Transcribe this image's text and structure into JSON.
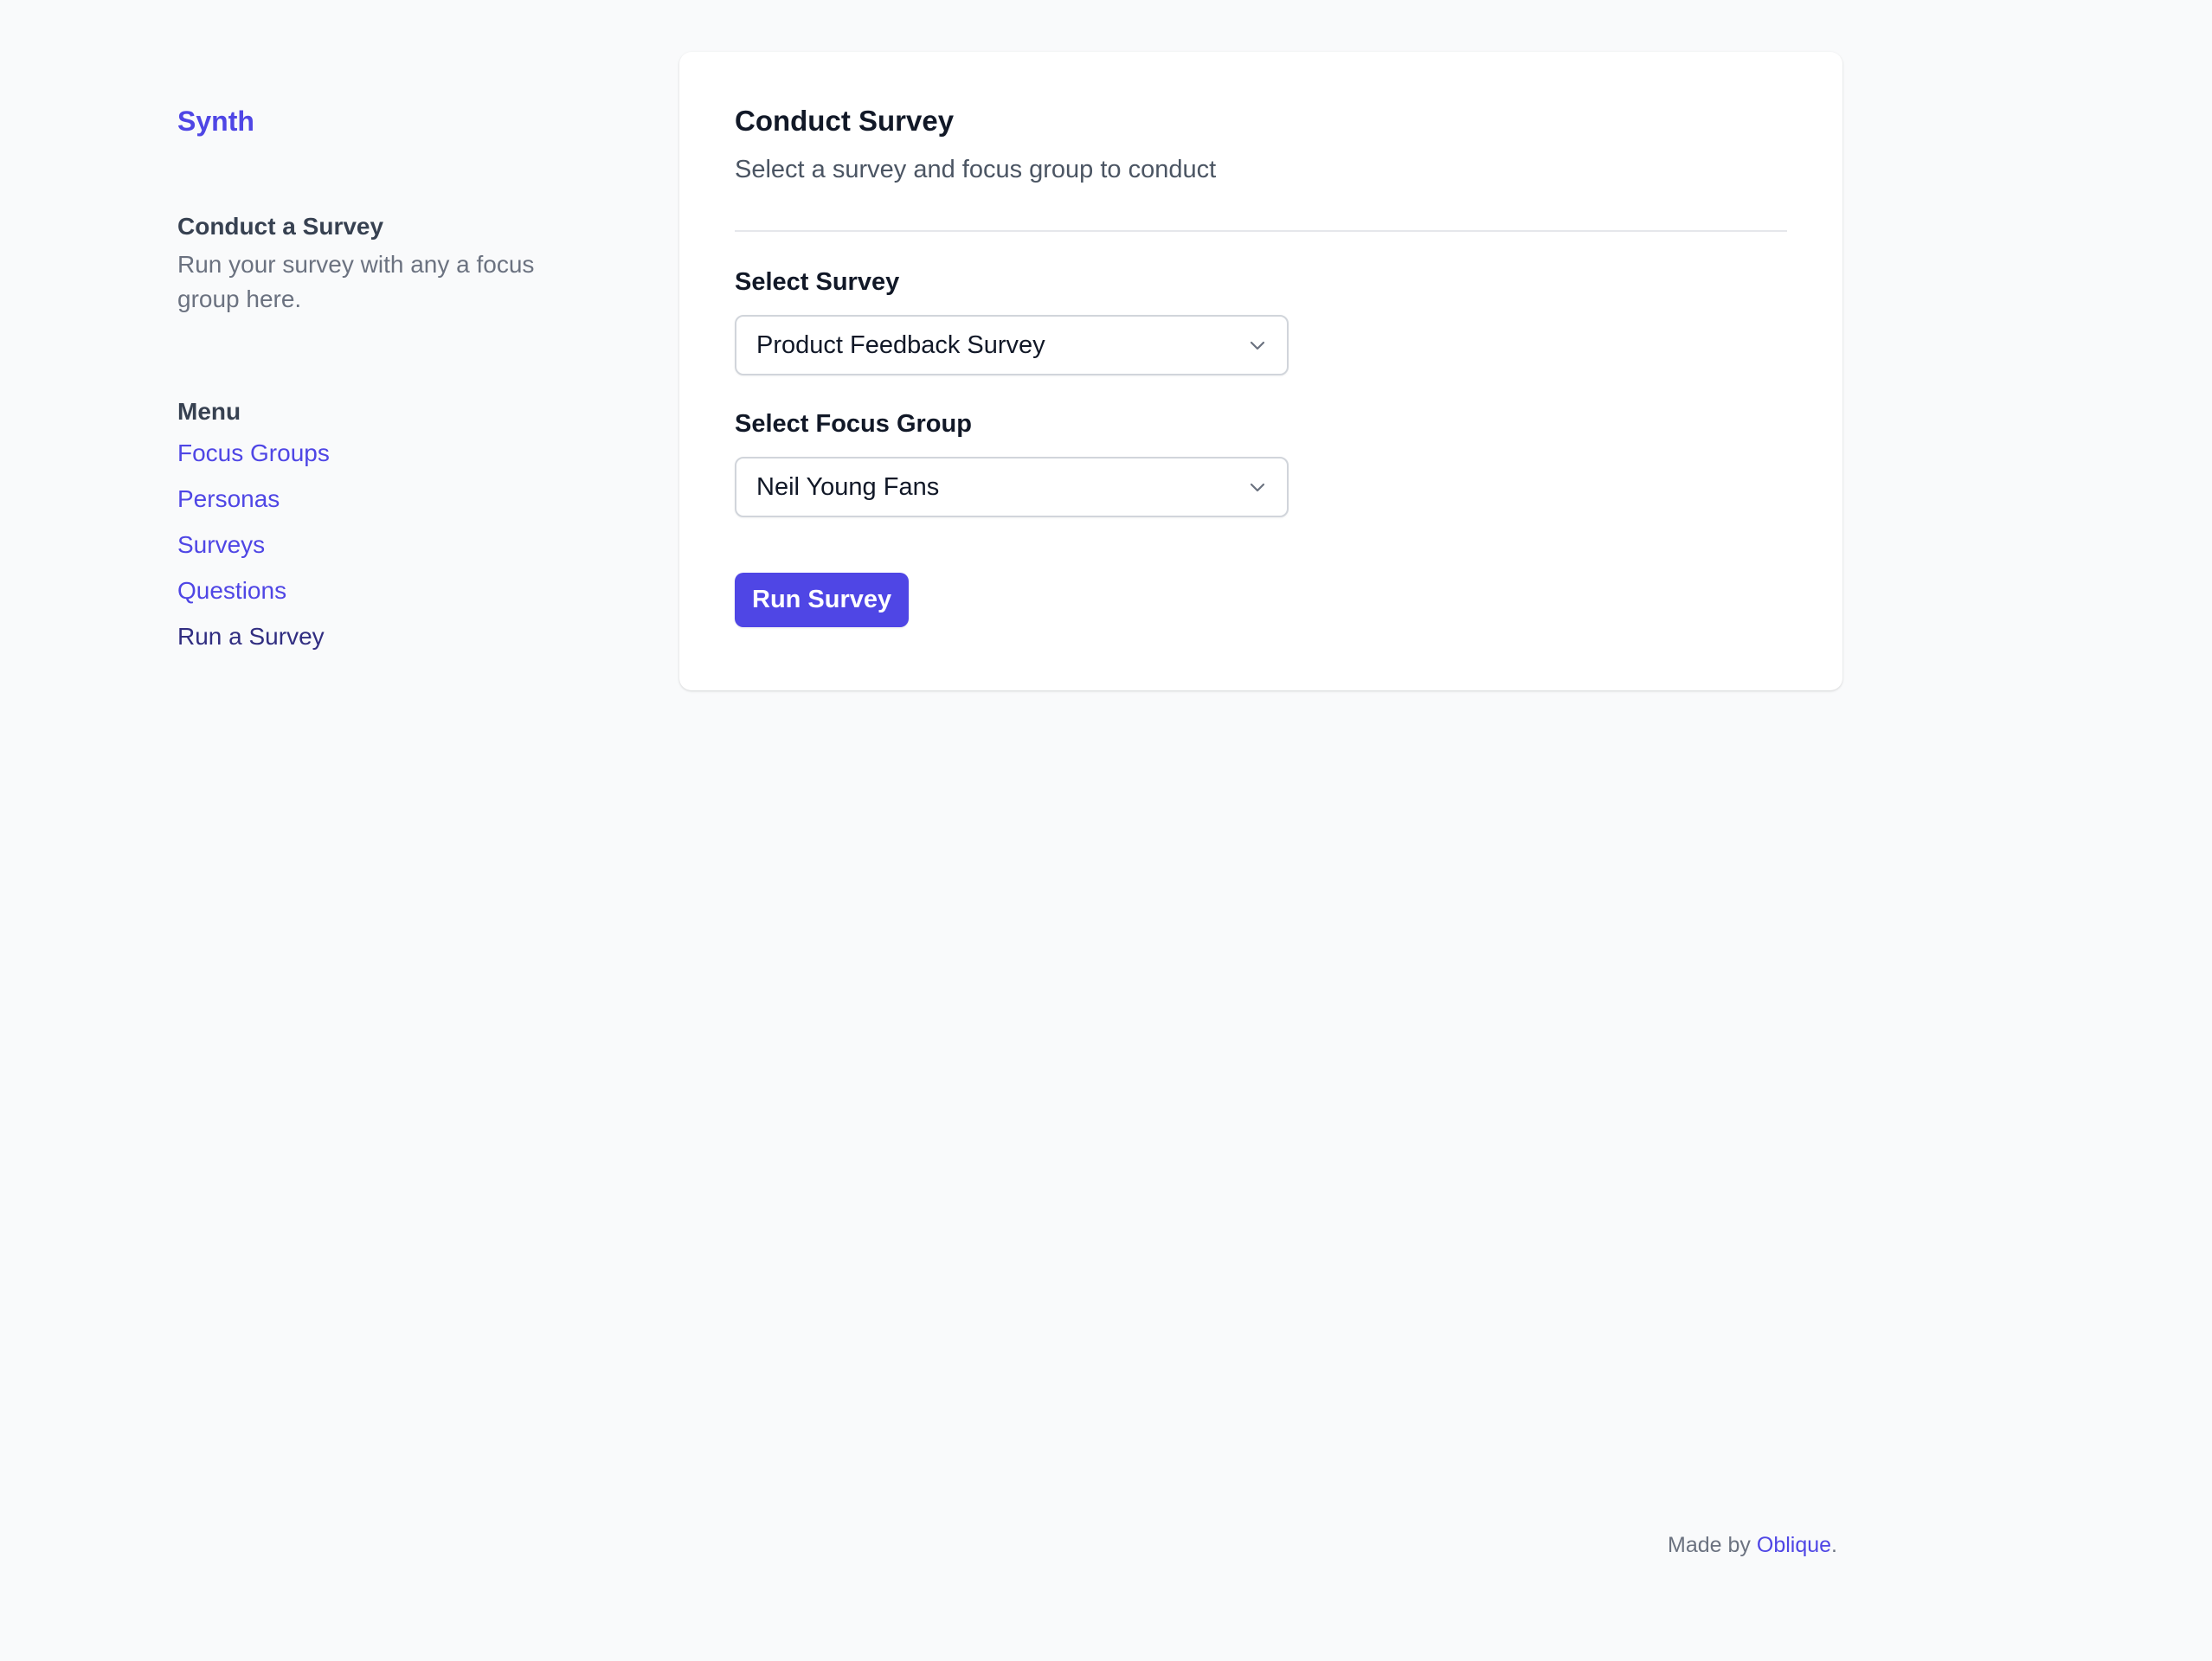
{
  "app": {
    "brand": "Synth"
  },
  "sidebar": {
    "section_title": "Conduct a Survey",
    "section_description": "Run your survey with any a focus group here.",
    "menu_title": "Menu",
    "items": [
      {
        "label": "Focus Groups",
        "active": false
      },
      {
        "label": "Personas",
        "active": false
      },
      {
        "label": "Surveys",
        "active": false
      },
      {
        "label": "Questions",
        "active": false
      },
      {
        "label": "Run a Survey",
        "active": true
      }
    ]
  },
  "card": {
    "title": "Conduct Survey",
    "subtitle": "Select a survey and focus group to conduct",
    "survey_field": {
      "label": "Select Survey",
      "value": "Product Feedback Survey",
      "icon": "chevron-down-icon"
    },
    "focus_group_field": {
      "label": "Select Focus Group",
      "value": "Neil Young Fans",
      "icon": "chevron-down-icon"
    },
    "submit_label": "Run Survey"
  },
  "footer": {
    "prefix": "Made by ",
    "link_label": "Oblique",
    "suffix": "."
  },
  "colors": {
    "accent": "#4f46e5",
    "active_link": "#312e81",
    "background": "#f9fafb"
  }
}
